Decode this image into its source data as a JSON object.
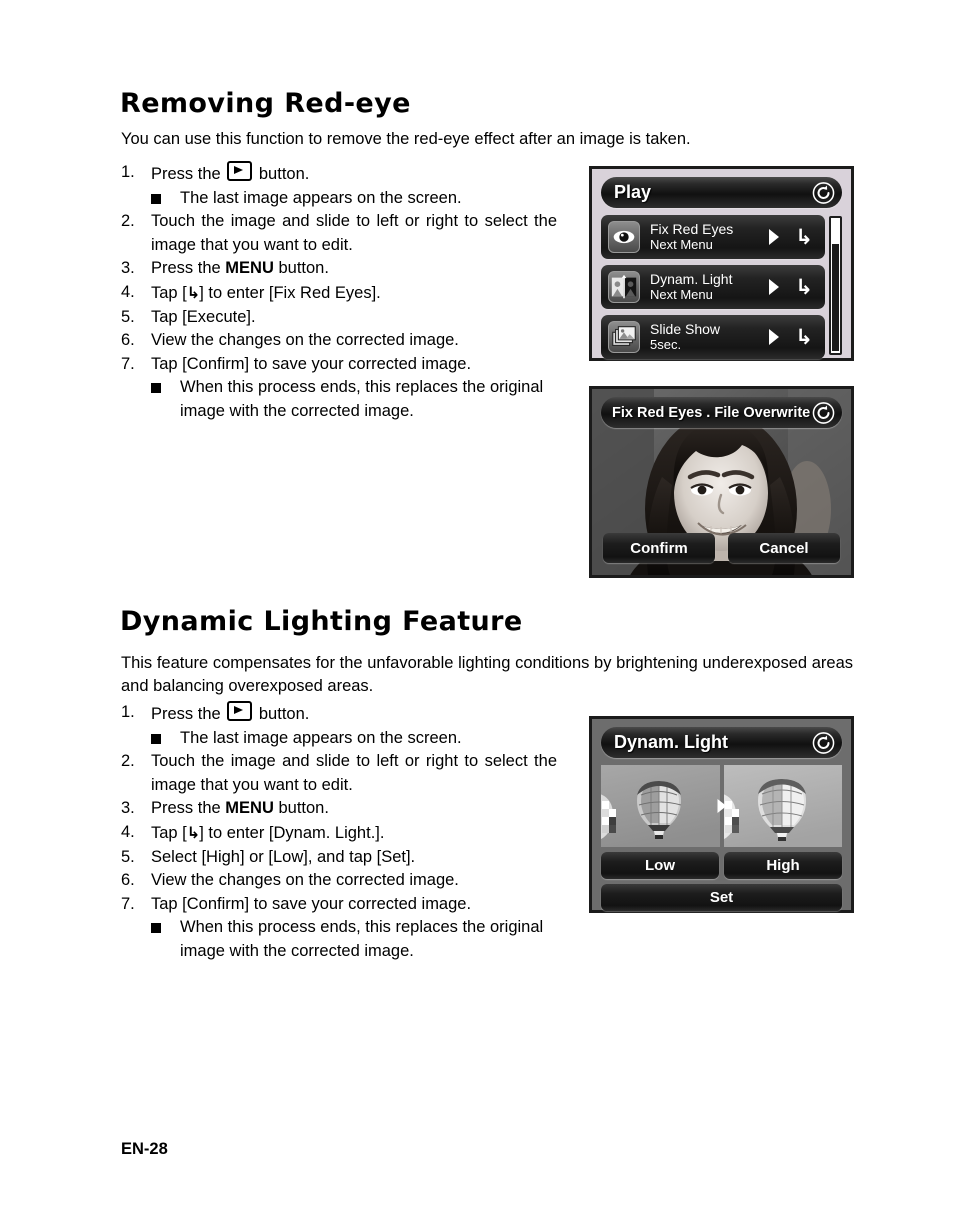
{
  "sections": [
    {
      "heading": "Removing Red-eye",
      "intro": "You can use this function to remove the red-eye effect after an image is taken.",
      "steps": [
        {
          "num": "1.",
          "pre": "Press the ",
          "icon": "playback-icon",
          "post": " button.",
          "subs": [
            "The last image appears on the screen."
          ]
        },
        {
          "num": "2.",
          "text": "Touch the image and slide to left or right to select the image that you want to edit.",
          "justify": true
        },
        {
          "num": "3.",
          "pre": "Press the ",
          "bold": "MENU",
          "post": " button."
        },
        {
          "num": "4.",
          "pre": "Tap [",
          "arrow": "↳",
          "post": "] to enter [Fix Red Eyes]."
        },
        {
          "num": "5.",
          "text": "Tap  [Execute]."
        },
        {
          "num": "6.",
          "text": "View the changes on the corrected image."
        },
        {
          "num": "7.",
          "text": "Tap [Confirm] to save your corrected image.",
          "subs": [
            "When this process ends, this replaces the original image with the corrected image."
          ],
          "subs_justify": true
        }
      ]
    },
    {
      "heading": "Dynamic Lighting Feature",
      "intro": "This feature compensates for the unfavorable lighting conditions by brightening underexposed areas and balancing overexposed areas.",
      "intro_justify": true,
      "steps": [
        {
          "num": "1.",
          "pre": "Press the ",
          "icon": "playback-icon",
          "post": " button.",
          "subs": [
            "The last image appears on the screen."
          ]
        },
        {
          "num": "2.",
          "text": "Touch the image and slide to left or right to select the image that you want to edit.",
          "justify": true
        },
        {
          "num": "3.",
          "pre": "Press the ",
          "bold": "MENU",
          "post": " button."
        },
        {
          "num": "4.",
          "pre": "Tap [",
          "arrow": "↳",
          "post": "] to enter [Dynam. Light.]."
        },
        {
          "num": "5.",
          "text": "Select [High] or [Low], and tap [Set]."
        },
        {
          "num": "6.",
          "text": "View the changes on the corrected image."
        },
        {
          "num": "7.",
          "text": "Tap [Confirm] to save your corrected image.",
          "subs": [
            "When this process ends, this replaces the original image with the corrected image."
          ],
          "subs_justify": true
        }
      ]
    }
  ],
  "screens": {
    "play_menu": {
      "title": "Play",
      "refresh_icon": "refresh-circular-arrow-icon",
      "rows": [
        {
          "icon": "eye-icon",
          "label": "Fix Red Eyes",
          "value": "Next Menu",
          "arrow_icon": "triangle-right-icon",
          "enter_icon": "↳"
        },
        {
          "icon": "dynamic-light-icon",
          "label": "Dynam. Light",
          "value": "Next Menu",
          "arrow_icon": "triangle-right-icon",
          "enter_icon": "↳"
        },
        {
          "icon": "slideshow-icon",
          "label": "Slide Show",
          "value": "5sec.",
          "arrow_icon": "triangle-right-icon",
          "enter_icon": "↳"
        }
      ],
      "scrollbar": "vertical-scrollbar"
    },
    "red_eye_overwrite": {
      "title": "Fix Red Eyes . File Overwrite",
      "refresh_icon": "refresh-circular-arrow-icon",
      "photo": "girl-portrait-photo",
      "confirm_label": "Confirm",
      "cancel_label": "Cancel"
    },
    "dynam_light": {
      "title": "Dynam. Light",
      "refresh_icon": "refresh-circular-arrow-icon",
      "preview_before": "balloon-photo-before",
      "preview_after": "balloon-photo-after",
      "low_label": "Low",
      "high_label": "High",
      "set_label": "Set"
    }
  },
  "footer": "EN-28",
  "colors": {
    "page_background": "#ffffff",
    "text": "#000000",
    "screen_border": "#1b1b1b",
    "play_screen_bg": "#d9d2da",
    "dynam_screen_bg": "#6d6d6d",
    "row_dark": "#151515",
    "row_text": "#ffffff"
  }
}
